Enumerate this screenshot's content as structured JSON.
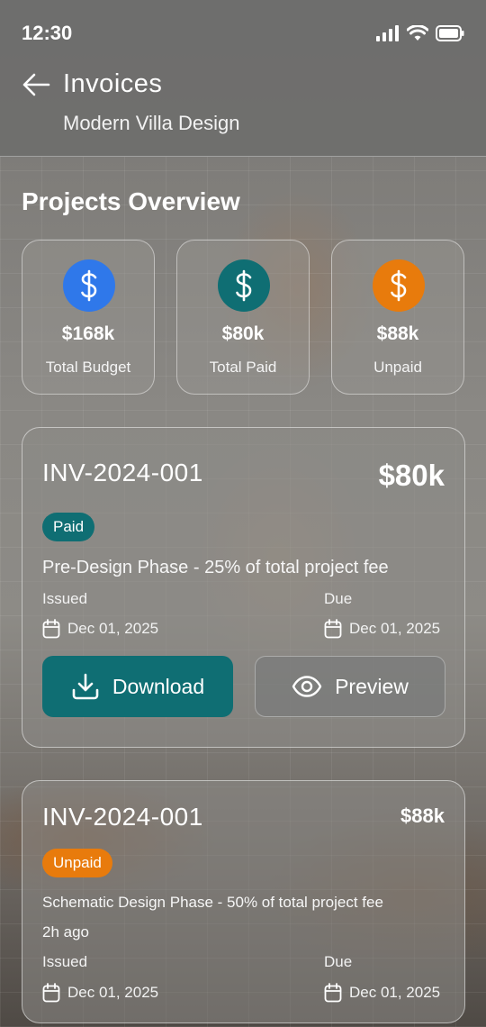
{
  "status_bar": {
    "time": "12:30"
  },
  "header": {
    "title": "Invoices",
    "subtitle": "Modern Villa Design"
  },
  "overview": {
    "title": "Projects Overview",
    "stats": [
      {
        "amount": "$168k",
        "label": "Total Budget",
        "color": "#2f78ea",
        "icon": "dollar-icon"
      },
      {
        "amount": "$80k",
        "label": "Total Paid",
        "color": "#0f6e73",
        "icon": "dollar-icon"
      },
      {
        "amount": "$88k",
        "label": "Unpaid",
        "color": "#e87b0c",
        "icon": "dollar-icon"
      }
    ]
  },
  "invoices": [
    {
      "id": "INV-2024-001",
      "amount": "$80k",
      "status": "Paid",
      "status_color": "#0f6e73",
      "description": "Pre-Design Phase - 25% of total project fee",
      "issued_label": "Issued",
      "issued_date": "Dec 01, 2025",
      "due_label": "Due",
      "due_date": "Dec 01, 2025",
      "download_label": "Download",
      "preview_label": "Preview"
    },
    {
      "id": "INV-2024-001",
      "amount": "$88k",
      "status": "Unpaid",
      "status_color": "#e87b0c",
      "description": "Schematic Design Phase - 50% of total project fee",
      "time_ago": "2h ago",
      "issued_label": "Issued",
      "issued_date": "Dec 01, 2025",
      "due_label": "Due",
      "due_date": "Dec 01, 2025"
    }
  ]
}
